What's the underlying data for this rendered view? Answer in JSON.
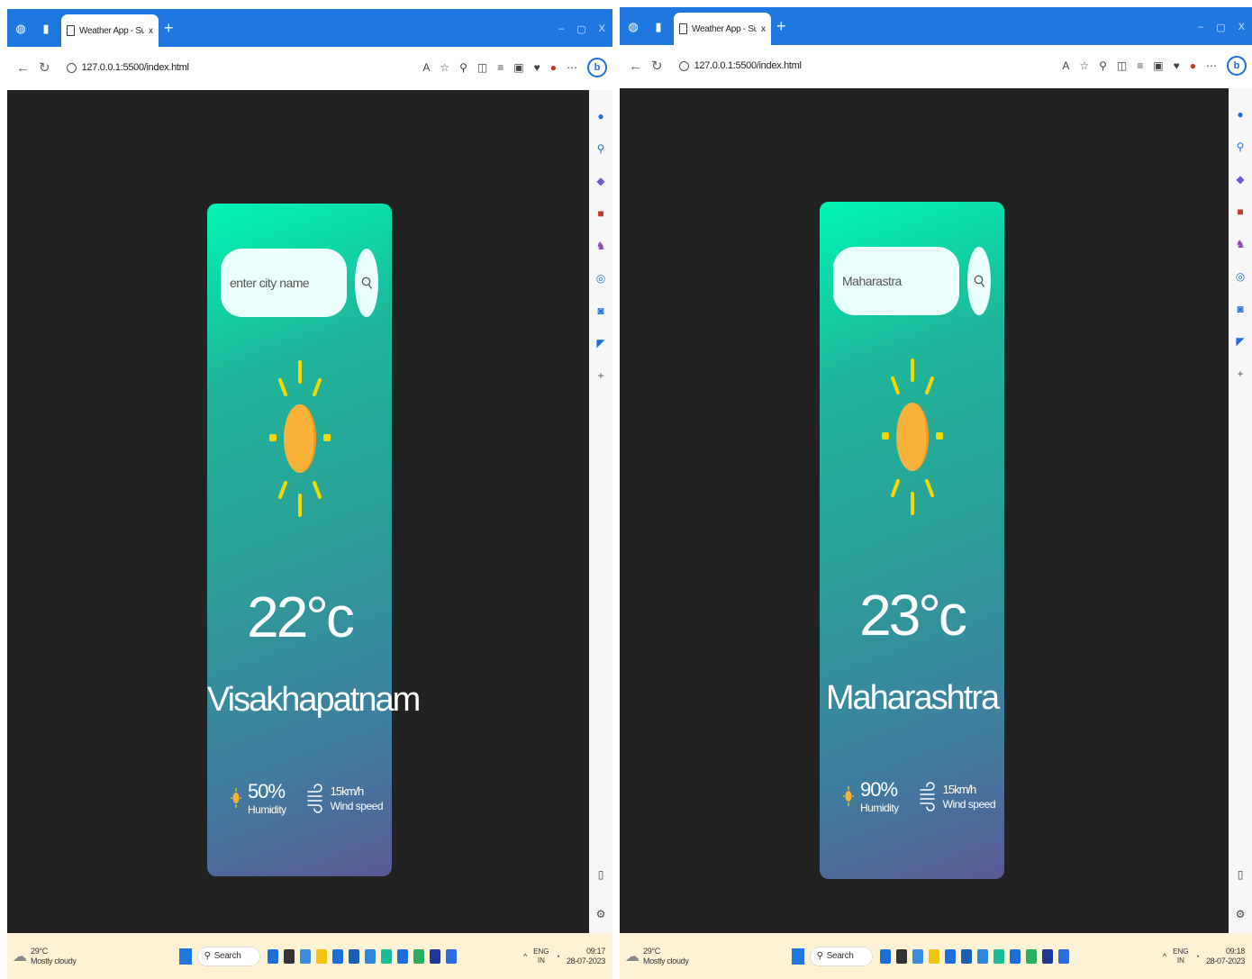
{
  "screens": [
    {
      "tab_title": "Weather App - Sumanth Manep",
      "url": "127.0.0.1:5500/index.html",
      "weather": {
        "placeholder": "enter city name",
        "input_value": "",
        "temperature": "22°c",
        "city": "Visakhapatnam",
        "humidity": "50%",
        "humidity_label": "Humidity",
        "wind": "15km/h",
        "wind_label": "Wind speed"
      },
      "taskbar": {
        "weather_temp": "29°C",
        "weather_desc": "Mostly cloudy",
        "search_label": "Search",
        "lang": "ENG",
        "region": "IN",
        "time": "09:17",
        "date": "28-07-2023"
      }
    },
    {
      "tab_title": "Weather App - Sumanth Manep",
      "url": "127.0.0.1:5500/index.html",
      "weather": {
        "placeholder": "enter city name",
        "input_value": "Maharastra",
        "temperature": "23°c",
        "city": "Maharashtra",
        "humidity": "90%",
        "humidity_label": "Humidity",
        "wind": "15km/h",
        "wind_label": "Wind speed"
      },
      "taskbar": {
        "weather_temp": "29°C",
        "weather_desc": "Mostly cloudy",
        "search_label": "Search",
        "lang": "ENG",
        "region": "IN",
        "time": "09:18",
        "date": "28-07-2023"
      }
    }
  ],
  "browser_controls": {
    "minimize": "–",
    "restore": "▢",
    "close": "X",
    "new_tab": "+",
    "tab_close": "x"
  },
  "colors": {
    "card_top": "#00f5b4",
    "card_bottom": "#5a5b94",
    "sun_body": "#f9b13a",
    "sun_rays": "#f5d800",
    "page_bg": "#222222",
    "titlebar": "#1e78e0"
  },
  "icons": [
    "back-arrow-icon",
    "refresh-icon",
    "info-icon",
    "read-aloud-icon",
    "favorite-star-icon",
    "search-icon",
    "sun-icon",
    "humidity-icon",
    "wind-icon",
    "bing-icon",
    "gear-icon"
  ]
}
